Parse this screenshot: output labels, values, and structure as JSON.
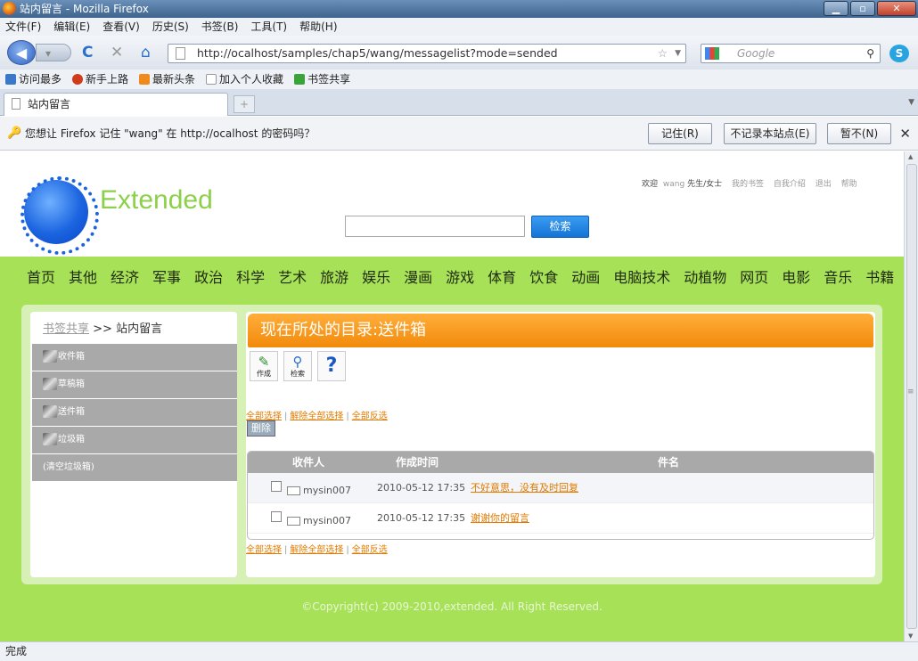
{
  "window": {
    "title": "站内留言 - Mozilla Firefox",
    "min": "▁",
    "max": "▫",
    "close": "✕"
  },
  "menu": [
    "文件(F)",
    "编辑(E)",
    "查看(V)",
    "历史(S)",
    "书签(B)",
    "工具(T)",
    "帮助(H)"
  ],
  "nav": {
    "back": "◀",
    "forward": "▾",
    "reload": "C",
    "stop": "✕",
    "home": "⌂",
    "url": "http://ocalhost/samples/chap5/wang/messagelist?mode=sended",
    "star": "☆",
    "dropdown": "▼",
    "search_engine": "Google",
    "search_icon": "⚲",
    "skype_icon": "S"
  },
  "bookmarks": [
    {
      "label": "访问最多",
      "color": "#3a78c9"
    },
    {
      "label": "新手上路",
      "color": "#d23a1c"
    },
    {
      "label": "最新头条",
      "color": "#f08a1c"
    },
    {
      "label": "加入个人收藏",
      "color": "#ffffff"
    },
    {
      "label": "书签共享",
      "color": "#3aa43a"
    }
  ],
  "tab": {
    "label": "站内留言",
    "new_tab": "+",
    "scroll": "▼"
  },
  "password_bar": {
    "icon": "🔑",
    "message": "您想让 Firefox 记住 \"wang\" 在 http://ocalhost 的密码吗？",
    "remember": "记住(R)",
    "never": "不记录本站点(E)",
    "not_now": "暂不(N)",
    "close": "✕"
  },
  "site": {
    "brand": "Extended",
    "welcome": {
      "prefix": "欢迎",
      "user": "wang",
      "title": "先生/女士",
      "links": [
        "我的书签",
        "自我介绍",
        "退出",
        "帮助"
      ]
    },
    "search_button": "检索",
    "categories": [
      "首页",
      "其他",
      "经济",
      "军事",
      "政治",
      "科学",
      "艺术",
      "旅游",
      "娱乐",
      "漫画",
      "游戏",
      "体育",
      "饮食",
      "动画",
      "电脑技术",
      "动植物",
      "网页",
      "电影",
      "音乐",
      "书籍"
    ],
    "breadcrumb": {
      "link": "书签共享",
      "sep": ">>",
      "current": "站内留言"
    },
    "left_nav": [
      "收件箱",
      "草稿箱",
      "送件箱",
      "垃圾箱",
      "(清空垃圾箱)"
    ],
    "directory": "现在所处的目录:送件箱",
    "tools": [
      {
        "icon": "✎",
        "label": "作成"
      },
      {
        "icon": "⚲",
        "label": "检索"
      },
      {
        "icon": "?",
        "label": ""
      }
    ],
    "select_links": [
      "全部选择",
      "解除全部选择",
      "全部反选"
    ],
    "delete": "删除",
    "table": {
      "headers": [
        "收件人",
        "作成时间",
        "件名"
      ],
      "rows": [
        {
          "recipient": "mysin007",
          "time": "2010-05-12 17:35",
          "subject": "不好意思，没有及时回复"
        },
        {
          "recipient": "mysin007",
          "time": "2010-05-12 17:35",
          "subject": "谢谢你的留言"
        }
      ]
    },
    "copyright": "©Copyright(c) 2009-2010,extended. All Right Reserved."
  },
  "status": "完成"
}
